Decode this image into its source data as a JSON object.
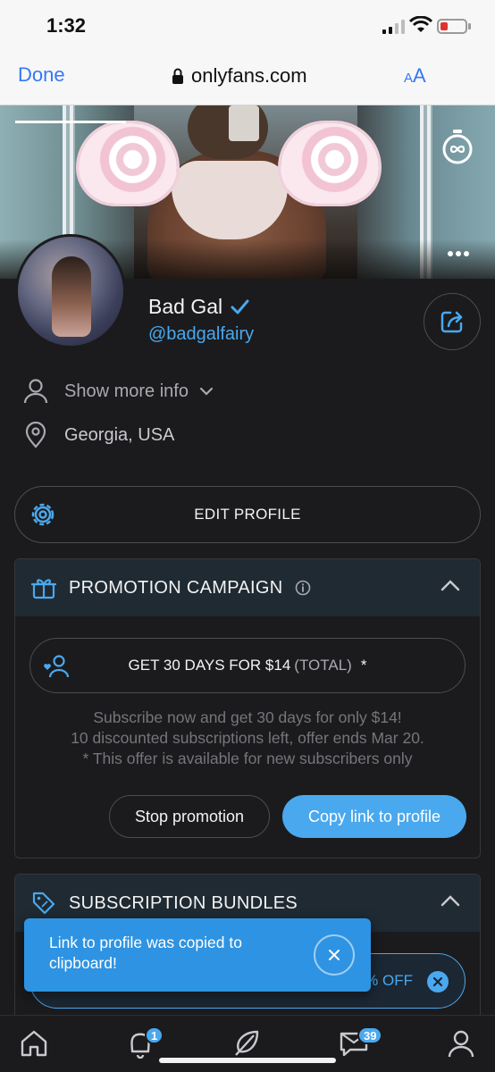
{
  "status_bar": {
    "time": "1:32"
  },
  "browser": {
    "done_label": "Done",
    "url": "onlyfans.com",
    "text_size_label": "A",
    "text_size_label_big": "A"
  },
  "profile": {
    "name": "Bad Gal",
    "handle": "@badgalfairy",
    "show_more_label": "Show more info",
    "location": "Georgia, USA",
    "edit_label": "EDIT PROFILE"
  },
  "promotion": {
    "title": "PROMOTION CAMPAIGN",
    "offer_main": "GET 30 DAYS FOR $14",
    "offer_suffix": "(TOTAL)",
    "offer_star": "*",
    "desc_line1": "Subscribe now and get 30 days for only $14!",
    "desc_line2": "10 discounted subscriptions left, offer ends Mar 20.",
    "desc_line3": "* This offer is available for new subscribers only",
    "stop_label": "Stop promotion",
    "copy_label": "Copy link to profile"
  },
  "bundles": {
    "title": "SUBSCRIPTION BUNDLES",
    "pill_visible_text": "% OFF"
  },
  "toast": {
    "message": "Link to profile was copied to clipboard!"
  },
  "tabbar": {
    "notifications_badge": "1",
    "messages_badge": "39"
  },
  "colors": {
    "accent": "#4aa8ee",
    "background": "#1b1b1d",
    "ios_blue": "#3478f6",
    "toast": "#2e93e2"
  }
}
